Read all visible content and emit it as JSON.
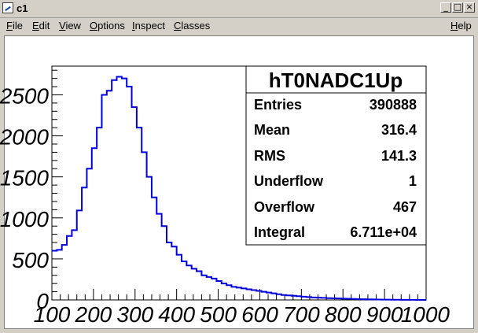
{
  "window": {
    "title": "c1"
  },
  "menu": {
    "left": [
      {
        "label": "File",
        "key": "F",
        "rest": "ile"
      },
      {
        "label": "Edit",
        "key": "E",
        "rest": "dit"
      },
      {
        "label": "View",
        "key": "V",
        "rest": "iew"
      },
      {
        "label": "Options",
        "key": "O",
        "rest": "ptions"
      },
      {
        "label": "Inspect",
        "key": "I",
        "rest": "nspect"
      },
      {
        "label": "Classes",
        "key": "C",
        "rest": "lasses"
      }
    ],
    "help": {
      "label": "Help",
      "key": "H",
      "rest": "elp"
    }
  },
  "stats": {
    "title": "hT0NADC1Up",
    "rows": [
      {
        "label": "Entries",
        "value": "390888"
      },
      {
        "label": "Mean",
        "value": "316.4"
      },
      {
        "label": "RMS",
        "value": "141.3"
      },
      {
        "label": "Underflow",
        "value": "1"
      },
      {
        "label": "Overflow",
        "value": "467"
      },
      {
        "label": "Integral",
        "value": "6.711e+04"
      }
    ]
  },
  "colors": {
    "line": "#0000e0",
    "axis": "#000000"
  },
  "chart_data": {
    "type": "step-histogram",
    "title": "",
    "xlabel": "",
    "ylabel": "",
    "xlim": [
      100,
      1000
    ],
    "ylim": [
      0,
      2850
    ],
    "bin_width": 12,
    "xticks": [
      100,
      200,
      300,
      400,
      500,
      600,
      700,
      800,
      900,
      1000
    ],
    "xtick_labels": [
      "100",
      "200",
      "300",
      "400",
      "500",
      "600",
      "700",
      "800",
      "900",
      "1000"
    ],
    "yticks": [
      0,
      500,
      1000,
      1500,
      2000,
      2500
    ],
    "ytick_labels": [
      "0",
      "500",
      "1000",
      "1500",
      "2000",
      "2500"
    ],
    "values": [
      600,
      610,
      670,
      780,
      850,
      1090,
      1370,
      1600,
      1850,
      2100,
      2500,
      2550,
      2680,
      2720,
      2700,
      2600,
      2350,
      2100,
      1800,
      1500,
      1250,
      1050,
      900,
      700,
      650,
      550,
      470,
      420,
      380,
      350,
      300,
      280,
      260,
      230,
      200,
      180,
      160,
      150,
      140,
      130,
      120,
      110,
      100,
      90,
      80,
      70,
      60,
      55,
      50,
      45,
      40,
      35,
      30,
      28,
      25,
      22,
      20,
      18,
      16,
      14,
      12,
      10,
      8,
      7,
      6,
      5,
      4,
      3,
      2,
      2,
      1,
      1,
      1,
      0,
      0
    ]
  }
}
